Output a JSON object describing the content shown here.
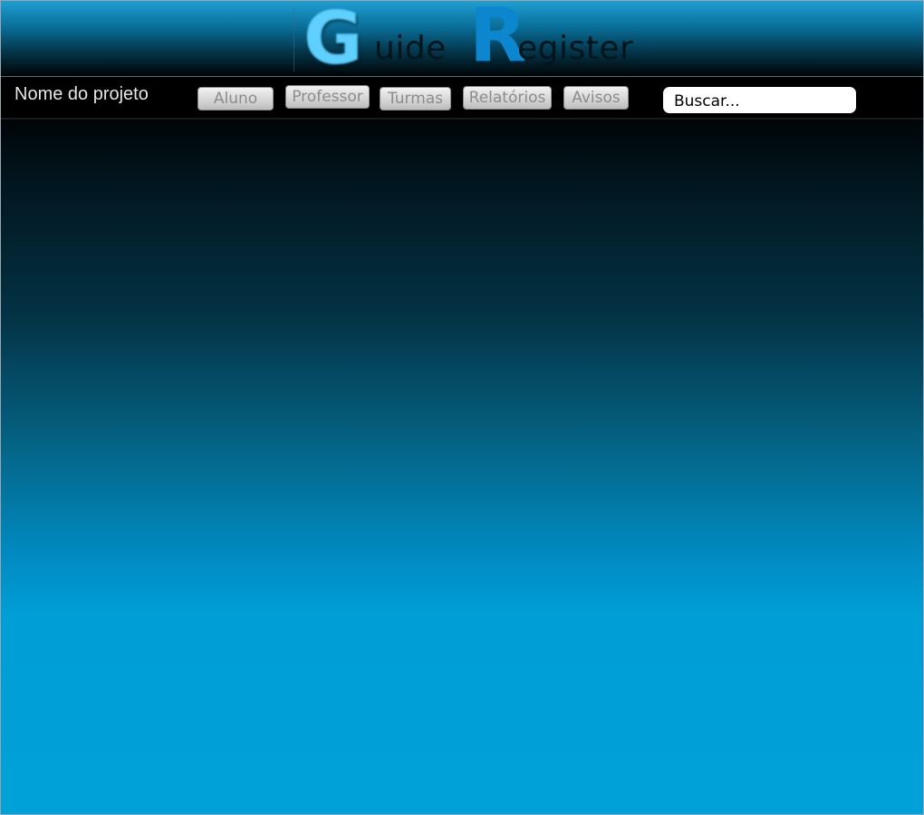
{
  "header": {
    "logo": {
      "initial_1": "G",
      "rest_1": "uide",
      "initial_2": "R",
      "rest_2": "egister"
    }
  },
  "navbar": {
    "project_name": "Nome do projeto",
    "buttons": [
      {
        "label": "Aluno"
      },
      {
        "label": "Professor"
      },
      {
        "label": "Turmas"
      },
      {
        "label": "Relatórios"
      },
      {
        "label": "Avisos"
      }
    ],
    "search": {
      "placeholder": "Buscar..."
    }
  },
  "colors": {
    "accent": "#0a8cd0",
    "header_top": "#1e9fd3",
    "navbar_bg": "#000000",
    "content_bottom": "#00a0d8"
  }
}
